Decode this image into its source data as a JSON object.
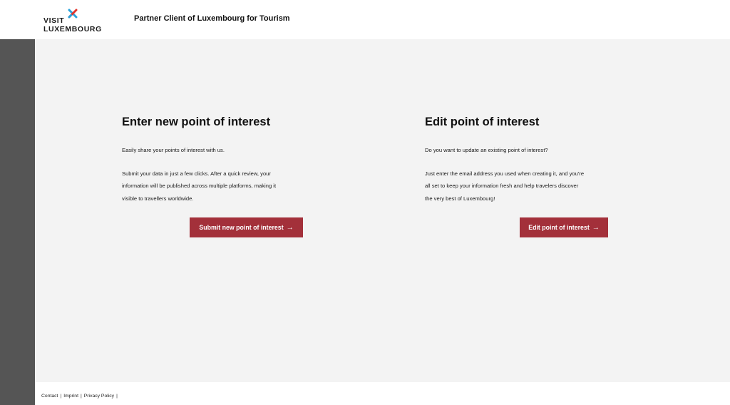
{
  "header": {
    "logo_line1": "VISIT",
    "logo_line2": "LUXEMBOURG",
    "title": "Partner Client of Luxembourg for Tourism"
  },
  "new_poi": {
    "title": "Enter new point of interest",
    "intro": "Easily share your points of interest with us.",
    "body_lines": [
      "Submit your data in just a few clicks. After a quick review, your",
      "information will be published across multiple platforms, making it",
      "visible to travellers worldwide."
    ],
    "button_label": "Submit new point of interest",
    "button_icon": "arrow-right-icon"
  },
  "edit_poi": {
    "title": "Edit point of interest",
    "intro": "Do you want to update an existing point of interest?",
    "body_lines": [
      "Just enter the email address you used when creating it, and you're",
      "all set to keep your information fresh and help travelers discover",
      "the very best of Luxembourg!"
    ],
    "button_label": "Edit point of interest",
    "button_icon": "arrow-right-icon"
  },
  "footer": {
    "links": [
      "Contact",
      "Imprint",
      "Privacy Policy"
    ],
    "separator": "|"
  },
  "colors": {
    "accent": "#a3303a",
    "sidebar": "#555555",
    "background": "#f3f3f3",
    "logo_red": "#e2342c",
    "logo_blue": "#29a3dc"
  }
}
